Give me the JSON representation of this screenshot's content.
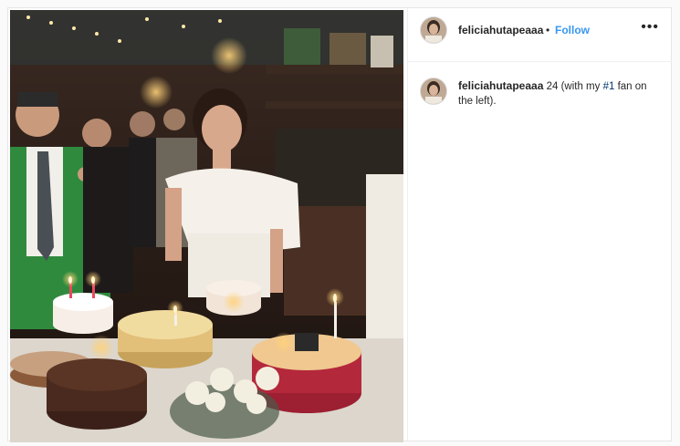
{
  "post": {
    "username": "feliciahutapeaaa",
    "separator": "•",
    "follow_label": "Follow",
    "more_label": "•••",
    "caption": {
      "username": "feliciahutapeaaa",
      "text_before": "24 (with my ",
      "hashtag": "#1",
      "text_after": " fan on the left)."
    },
    "photo": {
      "alt": "Birthday celebration with cakes and candles"
    }
  },
  "colors": {
    "accent": "#3897f0",
    "text": "#262626",
    "border": "#efefef",
    "hashtag": "#003569"
  },
  "icons": {
    "more": "more-options-icon"
  }
}
